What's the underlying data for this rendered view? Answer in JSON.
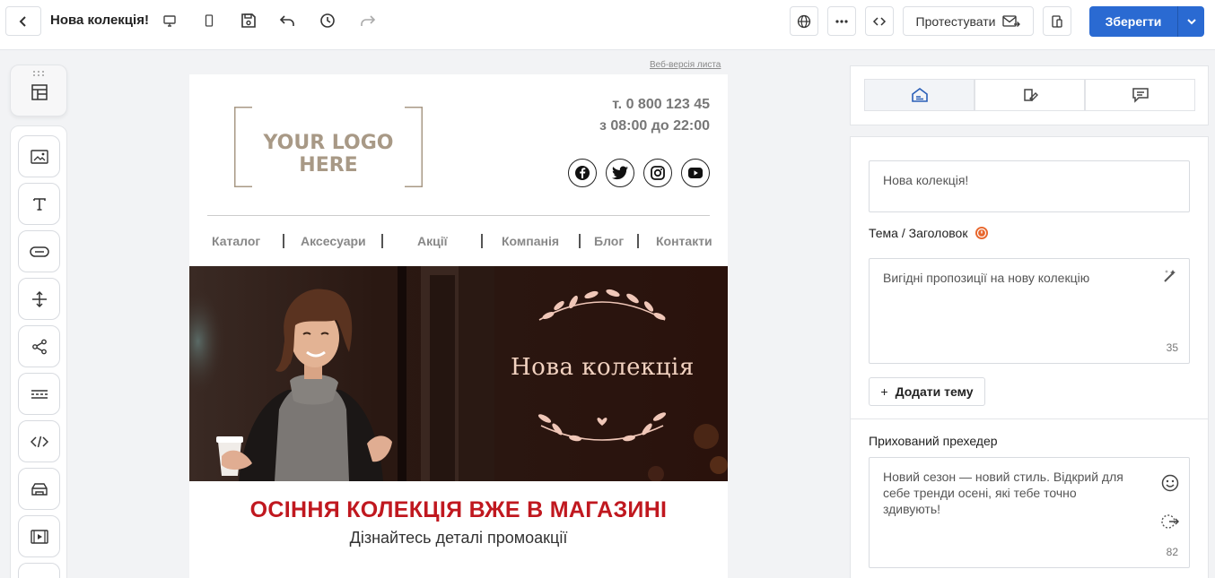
{
  "header": {
    "title": "Нова колекція!",
    "test_label": "Протестувати",
    "save_label": "Зберегти"
  },
  "email": {
    "web_version_link": "Веб-версія листа",
    "logo_text": "YOUR LOGO HERE",
    "phone": "т. 0 800 123 45",
    "hours": "з 08:00 до 22:00",
    "social": [
      "facebook-icon",
      "twitter-icon",
      "instagram-icon",
      "youtube-icon"
    ],
    "nav": [
      "Каталог",
      "Аксесуари",
      "Акції",
      "Компанія",
      "Блог",
      "Контакти"
    ],
    "hero_title": "Нова колекція",
    "headline": "ОСІННЯ КОЛЕКЦІЯ ВЖЕ В МАГАЗИНІ",
    "subline": "Дізнайтесь деталі промоакції"
  },
  "sidebar_tools": [
    "layout-icon",
    "image-icon",
    "text-icon",
    "button-icon",
    "spacer-icon",
    "social-icon",
    "divider-icon",
    "html-icon",
    "product-icon",
    "video-icon"
  ],
  "settings": {
    "tabs": [
      "envelope-settings-icon",
      "design-icon",
      "comments-icon"
    ],
    "sender_name": "Нова колекція!",
    "subject_label": "Тема / Заголовок",
    "subject_value": "Вигідні пропозиції на нову колекцію",
    "subject_count": "35",
    "add_subject_label": "Додати тему",
    "preheader_label": "Прихований прехедер",
    "preheader_value": "Новий сезон — новий стиль. Відкрий для себе тренди осені, які тебе точно здивують!",
    "preheader_count": "82"
  },
  "colors": {
    "accent": "#2a6ad2",
    "headline": "#c0181f",
    "hero_bg": "#2a1410",
    "hero_text": "#f2d2c0"
  }
}
